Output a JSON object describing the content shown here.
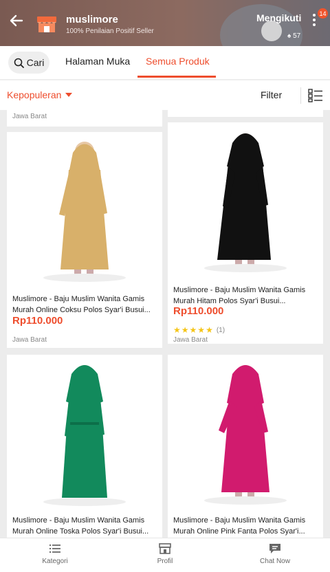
{
  "header": {
    "shop_name": "muslimore",
    "shop_subtitle": "100% Penilaian Positif Seller",
    "follow_label": "Mengikuti",
    "followers": "57",
    "notification_count": "14"
  },
  "tabs": {
    "search_label": "Cari",
    "home_label": "Halaman Muka",
    "all_products_label": "Semua Produk",
    "active": "Semua Produk"
  },
  "sortbar": {
    "sort_label": "Kepopuleran",
    "filter_label": "Filter"
  },
  "colors": {
    "accent": "#ee4d2d",
    "star": "#f5c518"
  },
  "products": [
    {
      "location": "Jawa Barat"
    },
    {
      "title": "Muslimore - Baju Muslim Wanita Gamis Murah Online Coksu Polos Syar'i Busui...",
      "price": "Rp110.000",
      "location": "Jawa Barat",
      "dress_color": "#d8b06a"
    },
    {
      "title": "Muslimore - Baju Muslim Wanita Gamis Murah Hitam Polos Syar'i Busui...",
      "price": "Rp110.000",
      "rating_stars": 5,
      "rating_count": "(1)",
      "location": "Jawa Barat",
      "dress_color": "#111111"
    },
    {
      "title": "Muslimore - Baju Muslim Wanita Gamis Murah Online Toska Polos Syar'i Busui...",
      "dress_color": "#128a5c"
    },
    {
      "title": "Muslimore - Baju Muslim Wanita Gamis Murah Online Pink Fanta Polos Syar'i...",
      "dress_color": "#d11b6e"
    }
  ],
  "bottom_nav": [
    {
      "label": "Kategori",
      "icon": "list-icon"
    },
    {
      "label": "Profil",
      "icon": "store-profile-icon"
    },
    {
      "label": "Chat Now",
      "icon": "chat-icon"
    }
  ]
}
